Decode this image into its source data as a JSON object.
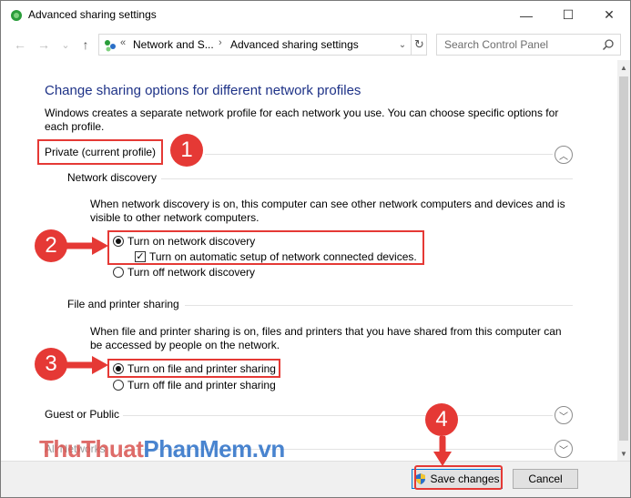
{
  "window": {
    "title": "Advanced sharing settings",
    "minimize": "—",
    "maximize": "☐",
    "close": "✕"
  },
  "nav": {
    "back": "←",
    "forward": "→",
    "recent": "⌄",
    "up": "↑",
    "breadcrumb_prefix": "«",
    "breadcrumb_1": "Network and S...",
    "breadcrumb_sep": "›",
    "breadcrumb_2": "Advanced sharing settings",
    "dropdown": "⌄",
    "refresh": "↻",
    "search_placeholder": "Search Control Panel"
  },
  "main": {
    "heading": "Change sharing options for different network profiles",
    "intro": "Windows creates a separate network profile for each network you use. You can choose specific options for each profile.",
    "private_profile": {
      "label": "Private (current profile)",
      "network_discovery": {
        "title": "Network discovery",
        "description": "When network discovery is on, this computer can see other network computers and devices and is visible to other network computers.",
        "opt_on": "Turn on network discovery",
        "opt_auto": "Turn on automatic setup of network connected devices.",
        "opt_off": "Turn off network discovery"
      },
      "file_sharing": {
        "title": "File and printer sharing",
        "description": "When file and printer sharing is on, files and printers that you have shared from this computer can be accessed by people on the network.",
        "opt_on": "Turn on file and printer sharing",
        "opt_off": "Turn off file and printer sharing"
      }
    },
    "guest_profile": {
      "label": "Guest or Public"
    },
    "all_networks": {
      "label": "All Networks"
    }
  },
  "annotations": [
    "1",
    "2",
    "3",
    "4"
  ],
  "watermark": {
    "part1": "ThuThuat",
    "part2": "PhanMem",
    "part3": ".vn"
  },
  "footer": {
    "save": "Save changes",
    "cancel": "Cancel"
  },
  "colors": {
    "heading": "#1e3287",
    "annotation_red": "#e53935",
    "button_border_primary": "#0078d7"
  }
}
